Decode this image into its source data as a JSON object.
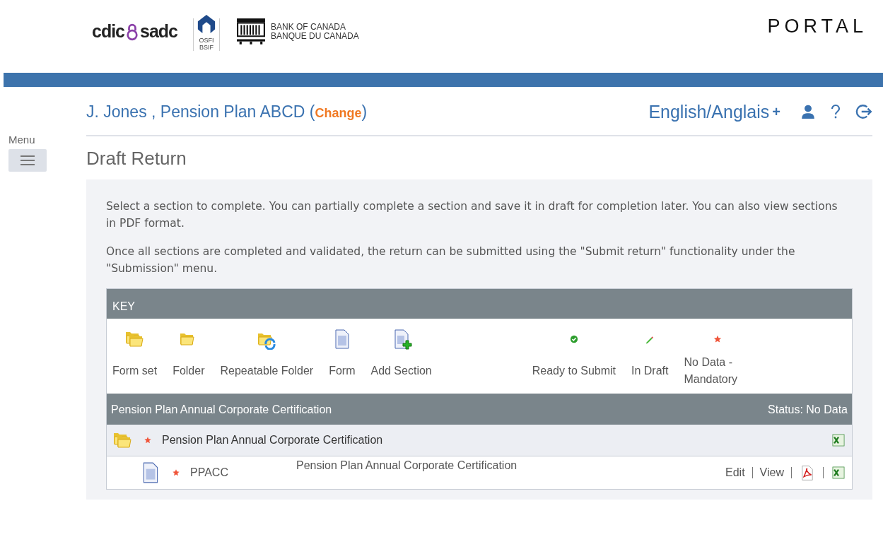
{
  "header": {
    "logos": {
      "cdic": "cdic",
      "sadc": "sadc",
      "osfi": "OSFI",
      "bsif": "BSIF",
      "bank_en": "BANK OF CANADA",
      "bank_fr": "BANQUE DU CANADA"
    },
    "portal_title": "PORTAL"
  },
  "menu": {
    "label": "Menu"
  },
  "user_bar": {
    "user": "J. Jones , Pension Plan ABCD (",
    "change_link": "Change",
    "closing": ")",
    "language": "English/Anglais",
    "language_plus": "+"
  },
  "page_title": "Draft Return",
  "intro": [
    "Select a section to complete. You can partially complete a section and save it in draft for completion later. You can also view sections in PDF format.",
    "Once all sections are completed and validated, the return can be submitted using the \"Submit return\" functionality under the \"Submission\" menu."
  ],
  "key": {
    "title": "KEY",
    "items": [
      {
        "kind": "formset",
        "label": "Form set"
      },
      {
        "kind": "folder",
        "label": "Folder"
      },
      {
        "kind": "repeatable",
        "label": "Repeatable Folder"
      },
      {
        "kind": "form",
        "label": "Form"
      },
      {
        "kind": "add",
        "label": "Add Section"
      },
      {
        "kind": "ready",
        "label": "Ready to Submit"
      },
      {
        "kind": "draft",
        "label": "In Draft"
      },
      {
        "kind": "mandatory",
        "label": "No Data - Mandatory"
      }
    ]
  },
  "section": {
    "title": "Pension Plan Annual Corporate Certification",
    "status": "Status: No Data",
    "rows": [
      {
        "kind": "formset",
        "mandatory": true,
        "name": "Pension Plan Annual Corporate Certification",
        "children": [
          {
            "kind": "form",
            "mandatory": true,
            "name": "PPACC",
            "description": "Pension Plan Annual Corporate Certification",
            "actions": [
              "Edit",
              "View"
            ]
          }
        ]
      }
    ]
  }
}
